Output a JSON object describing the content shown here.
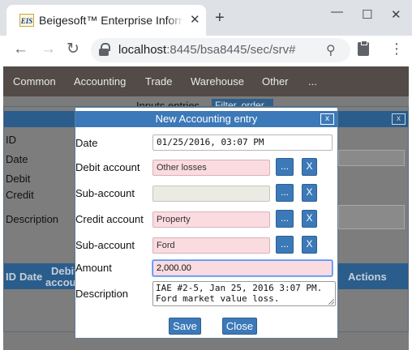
{
  "browser": {
    "tab_title": "Beigesoft™ Enterprise Information System",
    "favicon_text": "EIS",
    "new_tab_label": "+",
    "url_host": "localhost",
    "url_rest": ":8445/bsa8445/sec/srv#"
  },
  "navbar": {
    "items": [
      "Common",
      "Accounting",
      "Trade",
      "Warehouse",
      "Other",
      "..."
    ]
  },
  "background": {
    "heading": "Inputs entries",
    "filter_button": "Filter, order",
    "dialog_labels": [
      "ID",
      "Date",
      "Debit",
      "Credit",
      "Description"
    ],
    "table_headers": {
      "id": "ID",
      "date": "Date",
      "debit_line1": "Debit",
      "debit_line2": "account",
      "actions": "Actions"
    },
    "close_label": "x"
  },
  "modal": {
    "title": "New Accounting entry",
    "close_label": "x",
    "fields": {
      "date_label": "Date",
      "date_value": "01/25/2016, 03:07 PM",
      "debit_label": "Debit account",
      "debit_value": "Other losses",
      "subaccount_label": "Sub-account",
      "subaccount_value": "",
      "credit_label": "Credit account",
      "credit_value": "Property",
      "credit_sub_label": "Sub-account",
      "credit_sub_value": "Ford",
      "amount_label": "Amount",
      "amount_value": "2,000.00",
      "description_label": "Description",
      "description_value": "IAE #2-5, Jan 25, 2016 3:07 PM.\nFord market value loss."
    },
    "picker_label": "...",
    "clear_label": "X",
    "save_label": "Save",
    "close_button_label": "Close"
  }
}
